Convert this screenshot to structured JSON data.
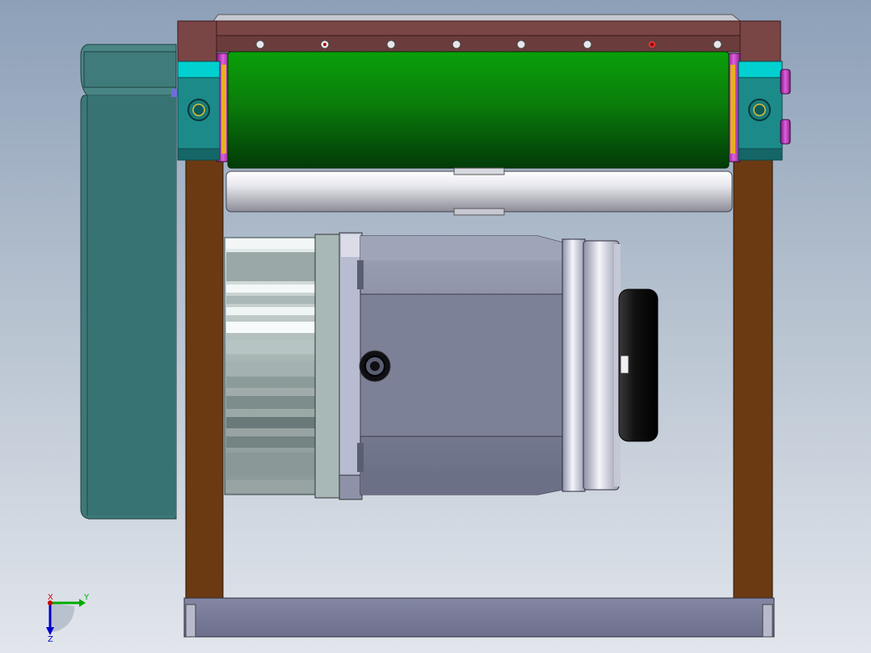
{
  "triad": {
    "x_label": "X",
    "y_label": "Y",
    "z_label": "Z"
  },
  "colors": {
    "background_top": "#8da0b8",
    "background_bottom": "#e2e6ec",
    "frame_top_bar": "#7a4545",
    "frame_leg": "#6b3a12",
    "roller": "#0a7a0a",
    "bearing_block": "#1d8a8a",
    "motor_body": "#8b8fa6",
    "guard_panel": "#3d7878",
    "highlight_magenta": "#c030c0",
    "axis_x": "#cc0000",
    "axis_y": "#00aa00",
    "axis_z": "#0000cc"
  }
}
